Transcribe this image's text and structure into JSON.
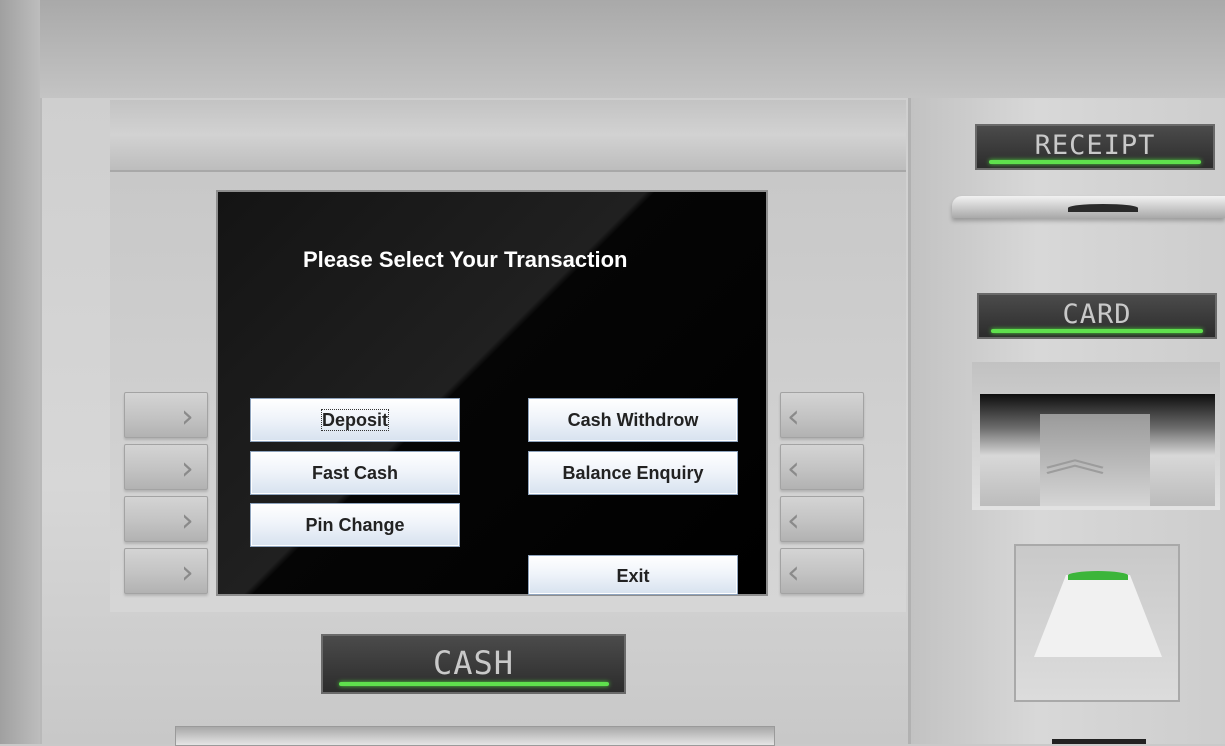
{
  "screen": {
    "title": "Please Select Your Transaction",
    "buttons": {
      "deposit": "Deposit",
      "fast_cash": "Fast Cash",
      "pin_change": "Pin Change",
      "cash_withdraw": "Cash Withdrow",
      "balance_enquiry": "Balance Enquiry",
      "exit": "Exit"
    }
  },
  "panel_labels": {
    "receipt": "RECEIPT",
    "card": "CARD",
    "cash": "CASH"
  },
  "icons": {
    "left_side_keys": "chevron-right-icon",
    "right_side_keys": "chevron-left-icon",
    "card_slot": "chevron-up-icon"
  },
  "colors": {
    "screen_background": "#000000",
    "indicator_green": "#5fe04d",
    "button_border": "#8ea3bd"
  }
}
